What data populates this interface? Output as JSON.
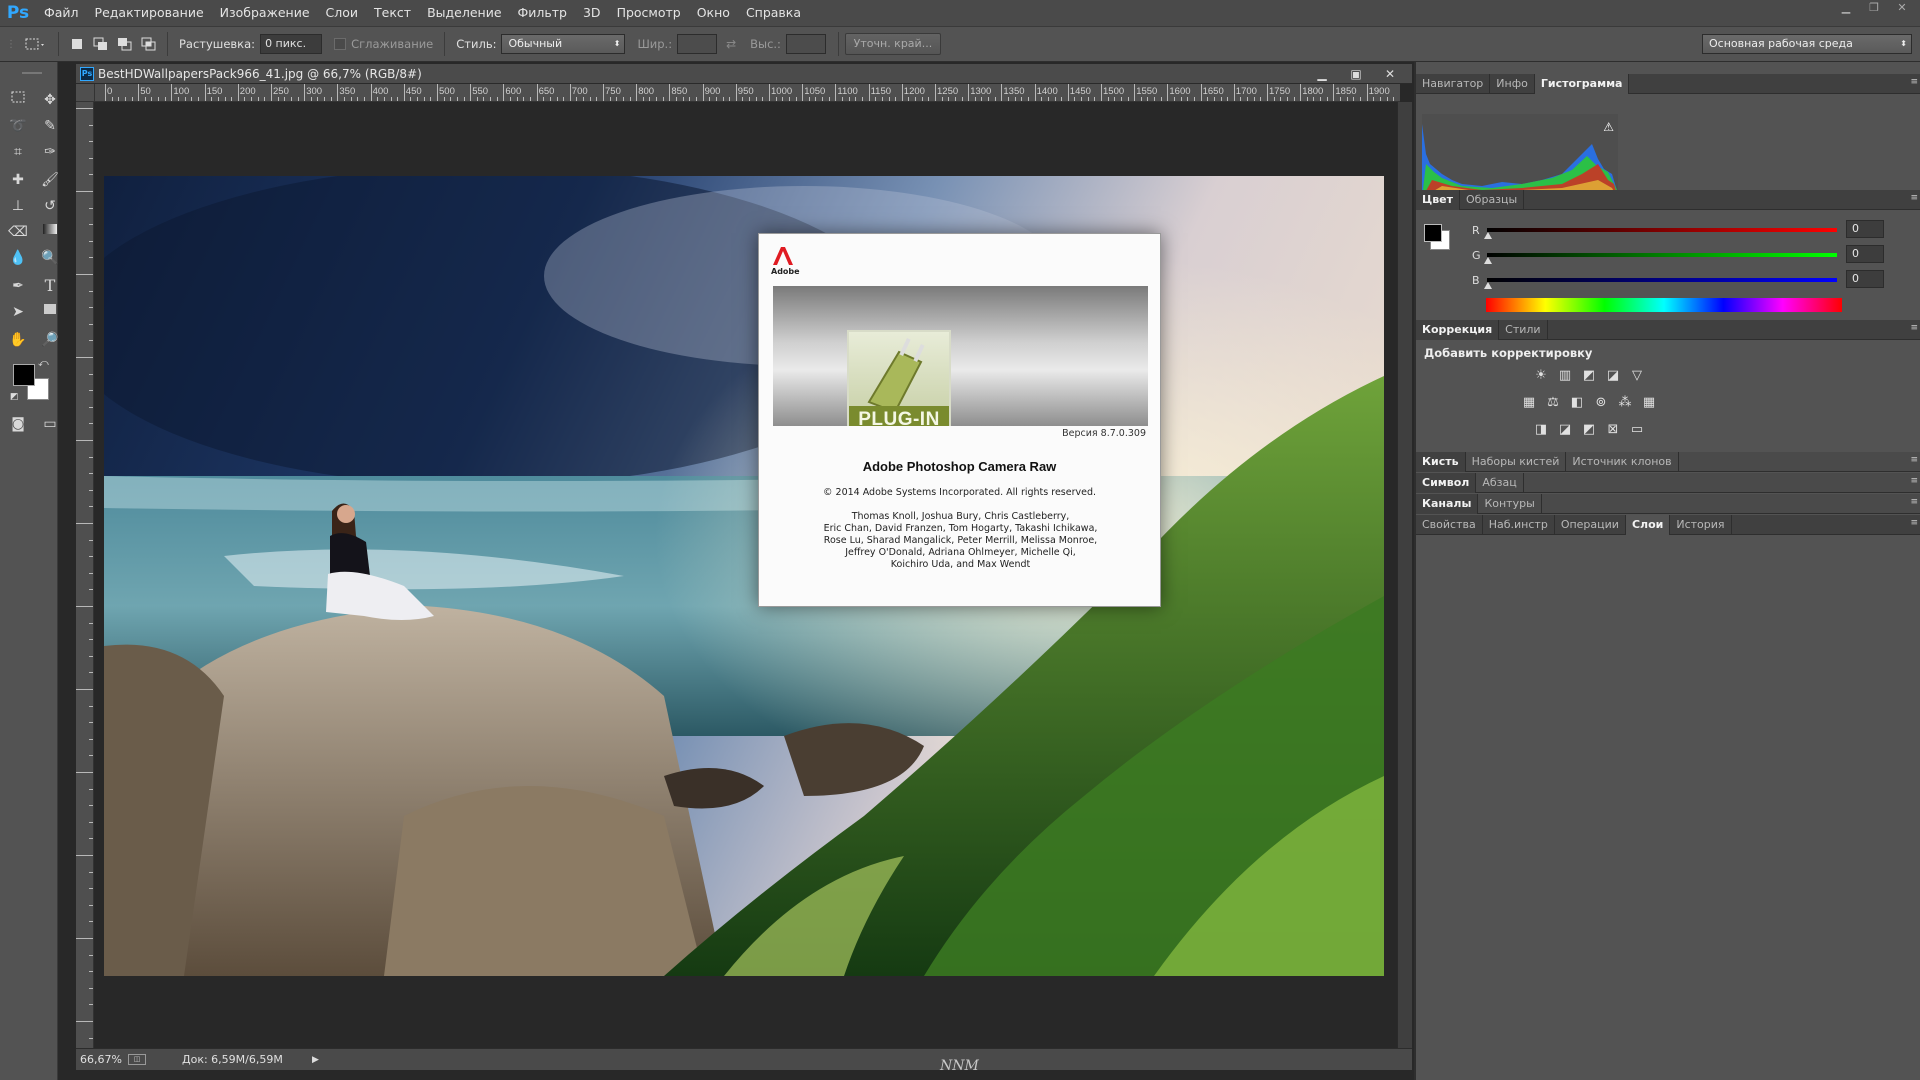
{
  "app": {
    "logo": "Ps"
  },
  "menu": [
    "Файл",
    "Редактирование",
    "Изображение",
    "Слои",
    "Текст",
    "Выделение",
    "Фильтр",
    "3D",
    "Просмотр",
    "Окно",
    "Справка"
  ],
  "options_bar": {
    "feather_label": "Растушевка:",
    "feather_value": "0 пикс.",
    "antialias_label": "Сглаживание",
    "style_label": "Стиль:",
    "style_value": "Обычный",
    "width_label": "Шир.:",
    "height_label": "Выс.:",
    "refine_button": "Уточн. край...",
    "workspace_value": "Основная рабочая среда"
  },
  "document": {
    "title": "BestHDWallpapersPack966_41.jpg @ 66,7% (RGB/8#)",
    "ps_icon": "Ps",
    "ruler_top_labels": [
      "0",
      "50",
      "100",
      "150",
      "200",
      "250",
      "300",
      "350",
      "400",
      "450",
      "500",
      "550",
      "600",
      "650",
      "700",
      "750",
      "800",
      "850",
      "900",
      "950",
      "1000",
      "1050",
      "1100",
      "1150",
      "1200",
      "1250",
      "1300",
      "1350",
      "1400",
      "1450",
      "1500",
      "1550",
      "1600",
      "1650",
      "1700",
      "1750",
      "1800",
      "1850",
      "1900"
    ],
    "zoom": "66,67%",
    "doc_size": "Док: 6,59M/6,59M"
  },
  "about_dialog": {
    "adobe_text": "Adobe",
    "plugin_label": "PLUG-IN",
    "version": "Версия 8.7.0.309",
    "title": "Adobe Photoshop Camera Raw",
    "copyright": "© 2014 Adobe Systems Incorporated. All rights reserved.",
    "credits": [
      "Thomas Knoll, Joshua Bury, Chris Castleberry,",
      "Eric Chan, David Franzen, Tom Hogarty, Takashi Ichikawa,",
      "Rose Lu, Sharad Mangalick, Peter Merrill, Melissa Monroe,",
      "Jeffrey O'Donald, Adriana Ohlmeyer, Michelle Qi,",
      "Koichiro Uda, and Max Wendt"
    ]
  },
  "panels": {
    "nav_tabs": [
      "Навигатор",
      "Инфо",
      "Гистограмма"
    ],
    "color_tabs": [
      "Цвет",
      "Образцы"
    ],
    "color_rgb": {
      "R": "0",
      "G": "0",
      "B": "0"
    },
    "adjust_tabs": [
      "Коррекция",
      "Стили"
    ],
    "adjust_heading": "Добавить корректировку",
    "brush_tabs": [
      "Кисть",
      "Наборы кистей",
      "Источник клонов"
    ],
    "type_tabs": [
      "Символ",
      "Абзац"
    ],
    "channels_tabs": [
      "Каналы",
      "Контуры"
    ],
    "layers_tabs": [
      "Свойства",
      "Наб.инстр",
      "Операции",
      "Слои",
      "История"
    ]
  },
  "watermark": "NNM",
  "colors": {
    "accent": "#31a8ff",
    "panel_bg": "#535353",
    "canvas_bg": "#282828"
  }
}
